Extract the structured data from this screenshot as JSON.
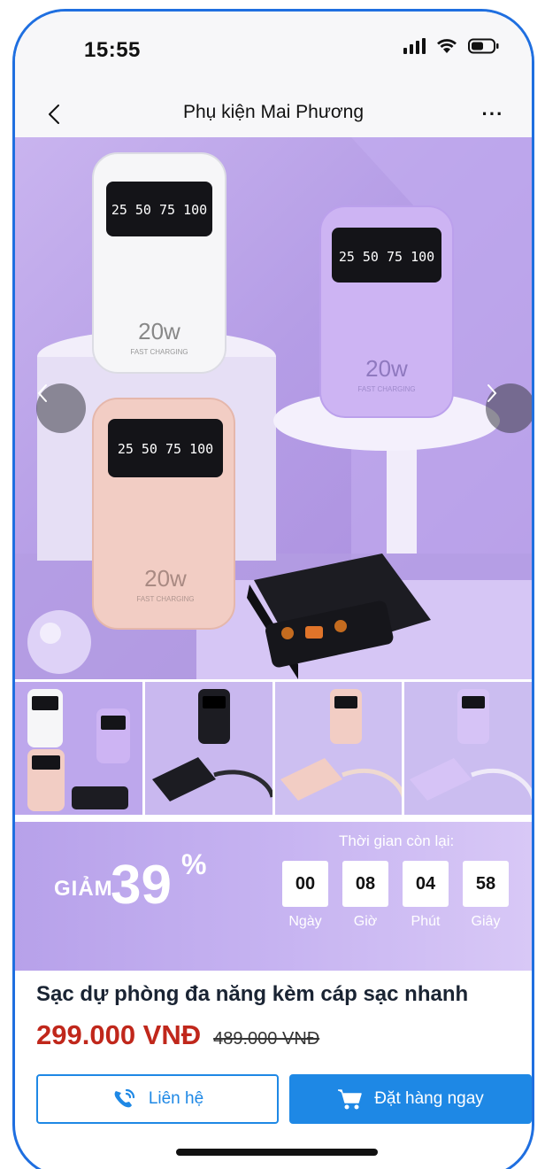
{
  "status_bar": {
    "time": "15:55"
  },
  "nav": {
    "title": "Phụ kiện Mai Phương",
    "back_icon": "chevron-left-icon",
    "more_icon": "ellipsis-icon",
    "more_label": "···"
  },
  "gallery": {
    "display_text": "25 50 75 100",
    "wattage": "20w",
    "caption": "FAST CHARGING",
    "thumbnail_count": 4
  },
  "promo": {
    "discount_prefix": "GIẢM",
    "discount_value": "39",
    "discount_unit": "%",
    "countdown_title": "Thời gian còn lại:",
    "countdown": [
      {
        "value": "00",
        "label": "Ngày"
      },
      {
        "value": "08",
        "label": "Giờ"
      },
      {
        "value": "04",
        "label": "Phút"
      },
      {
        "value": "58",
        "label": "Giây"
      }
    ]
  },
  "product": {
    "name": "Sạc dự phòng đa năng kèm cáp sạc nhanh",
    "sale_price": "299.000 VNĐ",
    "original_price": "489.000 VNĐ"
  },
  "actions": {
    "contact_label": "Liên hệ",
    "order_label": "Đặt hàng ngay"
  },
  "colors": {
    "accent": "#1e88e5",
    "price": "#c0271b",
    "promo_bg": "#c6b3f1"
  }
}
